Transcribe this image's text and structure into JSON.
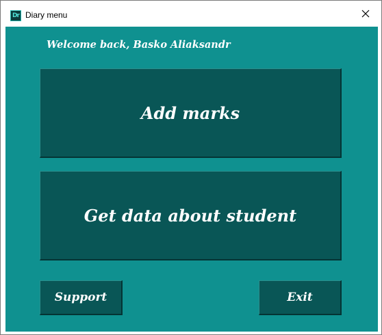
{
  "window": {
    "title": "Diary menu",
    "icon_label": "Dr",
    "close_label": "close-icon"
  },
  "colors": {
    "background": "#0f9190",
    "button": "#095656",
    "text": "#ffffff"
  },
  "main": {
    "welcome_text": "Welcome back, Basko Aliaksandr",
    "add_marks_label": "Add marks",
    "get_data_label": "Get data about student",
    "support_label": "Support",
    "exit_label": "Exit"
  }
}
